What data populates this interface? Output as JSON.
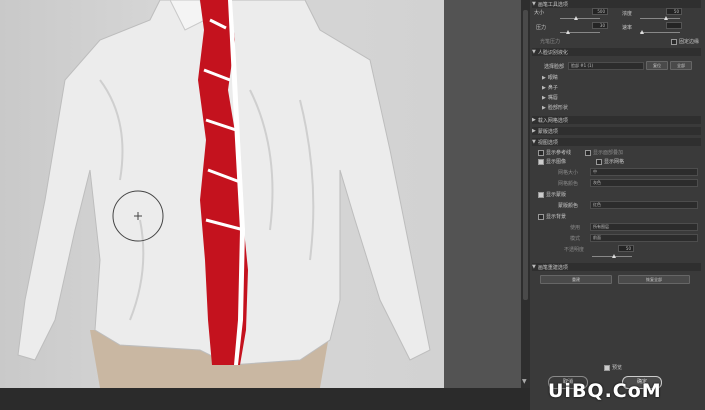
{
  "panel": {
    "brush_header": "画笔工具选项",
    "size_label": "大小",
    "size_value": "500",
    "density_label": "浓度",
    "density_value": "50",
    "pressure_label": "压力",
    "pressure_value": "30",
    "rate_label": "速率",
    "rate_value": "",
    "stylus_label": "光笔压力",
    "pin_edges_label": "固定边缘",
    "face_header": "人脸识别液化",
    "select_face_label": "选择脸部",
    "select_face_value": "脸部 #1 (1)",
    "reset_label": "复位",
    "all_label": "全部",
    "face_items": [
      "眼睛",
      "鼻子",
      "嘴唇",
      "脸部形状"
    ],
    "load_mesh_header": "载入网格选项",
    "mask_header": "蒙版选项",
    "view_header": "视图选项",
    "show_guides_label": "显示参考线",
    "show_face_overlay_label": "显示面部叠加",
    "show_image_label": "显示图像",
    "show_mesh_label": "显示网格",
    "mesh_size_label": "网格大小",
    "mesh_size_value": "中",
    "mesh_color_label": "网格颜色",
    "mesh_color_value": "灰色",
    "show_mask_label": "显示蒙版",
    "mask_color_label": "蒙版颜色",
    "mask_color_value": "红色",
    "show_backdrop_label": "显示背景",
    "use_label": "使用",
    "use_value": "所有图层",
    "mode_label": "模式",
    "mode_value": "前面",
    "opacity_label": "不透明度",
    "opacity_value": "50",
    "brush_rebuild_header": "画笔重建选项",
    "rebuild_label": "重建",
    "restore_all_label": "恢复全部",
    "preview_label": "预览",
    "cancel_label": "取消",
    "ok_label": "确定"
  },
  "watermark": "UiBQ.CoM",
  "colors": {
    "accent_red": "#c4121e",
    "panel_bg": "#3a3a3a"
  }
}
